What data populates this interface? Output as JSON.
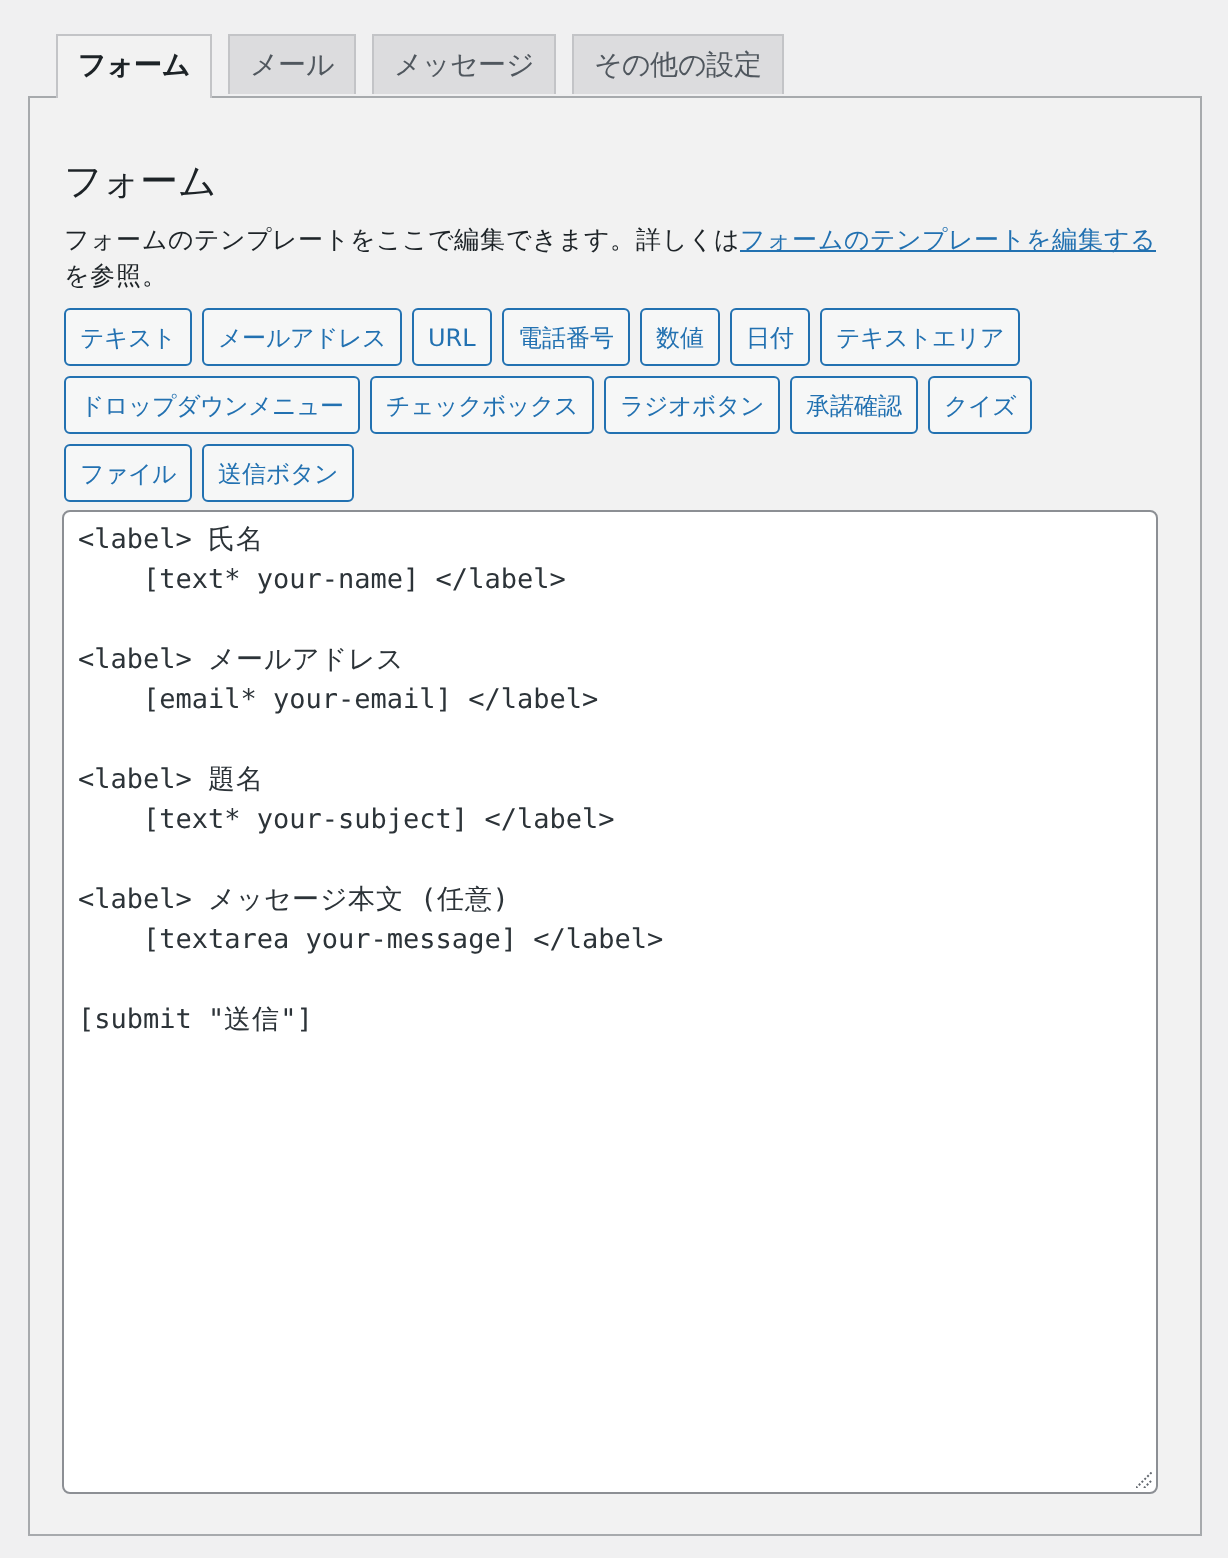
{
  "tabs": [
    {
      "label": "フォーム",
      "selected": true
    },
    {
      "label": "メール",
      "selected": false
    },
    {
      "label": "メッセージ",
      "selected": false
    },
    {
      "label": "その他の設定",
      "selected": false
    }
  ],
  "panel": {
    "heading": "フォーム",
    "description": "フォームのテンプレートをここで編集できます。詳しくは",
    "link": "フォームのテンプレートを編集する",
    "description_end": "を参照。"
  },
  "tag_buttons": [
    "テキスト",
    "メールアドレス",
    "URL",
    "電話番号",
    "数値",
    "日付",
    "テキストエリア",
    "ドロップダウンメニュー",
    "チェックボックス",
    "ラジオボタン",
    "承諾確認",
    "クイズ",
    "ファイル",
    "送信ボタン"
  ],
  "template": {
    "value": "<label> 氏名\n    [text* your-name] </label>\n\n<label> メールアドレス\n    [email* your-email] </label>\n\n<label> 題名\n    [text* your-subject] </label>\n\n<label> メッセージ本文 (任意)\n    [textarea your-message] </label>\n\n[submit \"送信\"]"
  }
}
